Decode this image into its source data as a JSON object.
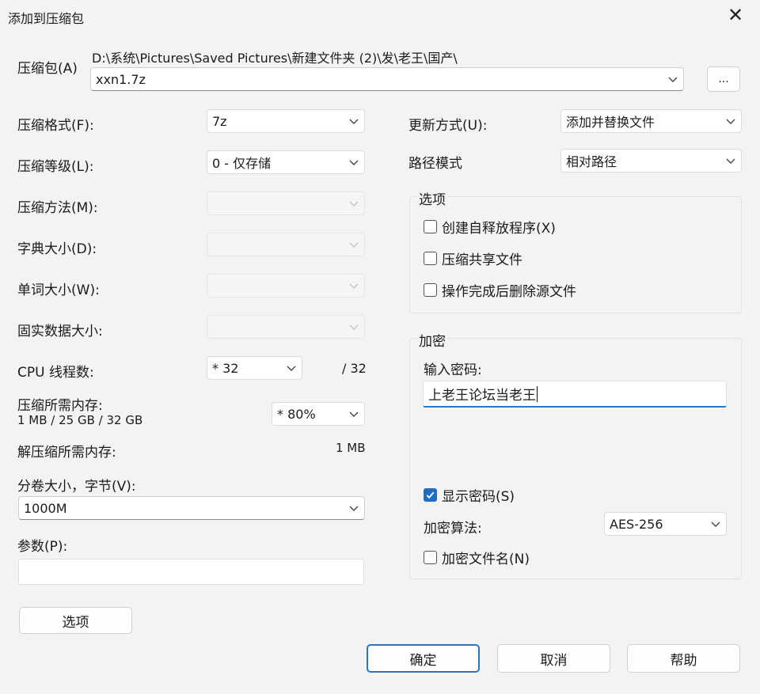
{
  "window": {
    "title": "添加到压缩包",
    "close_glyph": "✕"
  },
  "archive": {
    "label": "压缩包(A)",
    "path": "D:\\系统\\Pictures\\Saved Pictures\\新建文件夹 (2)\\发\\老王\\国产\\",
    "filename": "xxn1.7z",
    "browse_label": "..."
  },
  "left": {
    "format": {
      "label": "压缩格式(F):",
      "value": "7z"
    },
    "level": {
      "label": "压缩等级(L):",
      "value": "0 - 仅存储"
    },
    "method": {
      "label": "压缩方法(M):",
      "value": ""
    },
    "dict": {
      "label": "字典大小(D):",
      "value": ""
    },
    "word": {
      "label": "单词大小(W):",
      "value": ""
    },
    "solid": {
      "label": "固实数据大小:",
      "value": ""
    },
    "cpu": {
      "label": "CPU 线程数:",
      "value": "* 32",
      "max": "/ 32"
    },
    "mem_compress": {
      "label": "压缩所需内存:",
      "detail": "1 MB / 25 GB / 32 GB",
      "value": "* 80%"
    },
    "mem_decompress": {
      "label": "解压缩所需内存:",
      "value": "1 MB"
    },
    "volume": {
      "label": "分卷大小，字节(V):",
      "value": "1000M"
    },
    "params": {
      "label": "参数(P):",
      "value": ""
    },
    "options_button": "选项"
  },
  "right": {
    "update": {
      "label": "更新方式(U):",
      "value": "添加并替换文件"
    },
    "pathmode": {
      "label": "路径模式",
      "value": "相对路径"
    },
    "options": {
      "title": "选项",
      "items": [
        {
          "label": "创建自释放程序(X)",
          "checked": false
        },
        {
          "label": "压缩共享文件",
          "checked": false
        },
        {
          "label": "操作完成后删除源文件",
          "checked": false
        }
      ]
    },
    "encryption": {
      "title": "加密",
      "password_label": "输入密码:",
      "password_value": "上老王论坛当老王",
      "show_password": {
        "label": "显示密码(S)",
        "checked": true
      },
      "method_label": "加密算法:",
      "method_value": "AES-256",
      "encrypt_names": {
        "label": "加密文件名(N)",
        "checked": false
      }
    }
  },
  "footer": {
    "ok": "确定",
    "cancel": "取消",
    "help": "帮助"
  },
  "colors": {
    "accent": "#2a73c8",
    "background": "#f3f3f3"
  }
}
